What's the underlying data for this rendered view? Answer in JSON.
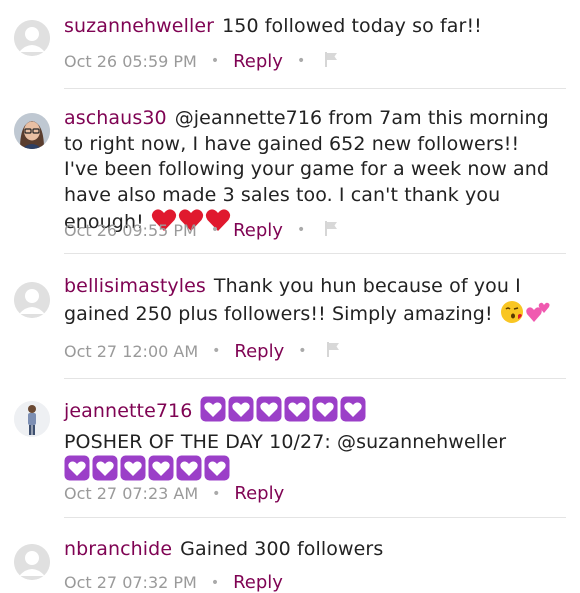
{
  "comments": [
    {
      "username": "suzannehweller",
      "text": "150 followed today so far!!",
      "timestamp": "Oct 26 05:59 PM",
      "reply_label": "Reply",
      "avatar": "default-avatar",
      "has_flag": true
    },
    {
      "username": "aschaus30",
      "text": "@jeannette716 from 7am this morning to right now, I have gained 652 new followers!! I've been following your game for a week now and have also made 3 sales too. I can't thank you enough!",
      "emojis": [
        "red-heart",
        "red-heart",
        "red-heart"
      ],
      "timestamp": "Oct 26 09:55 PM",
      "reply_label": "Reply",
      "avatar": "photo-avatar-woman-glasses",
      "has_flag": true
    },
    {
      "username": "bellisimastyles",
      "text": "Thank you hun because of you I gained 250 plus followers!! Simply amazing!",
      "emojis": [
        "kissing-face",
        "two-hearts"
      ],
      "timestamp": "Oct 27 12:00 AM",
      "reply_label": "Reply",
      "avatar": "default-avatar",
      "has_flag": true
    },
    {
      "username": "jeannette716",
      "text": "POSHER OF THE DAY 10/27: @suzannehweller",
      "emojis": [
        "heart-decoration",
        "heart-decoration",
        "heart-decoration",
        "heart-decoration",
        "heart-decoration",
        "heart-decoration"
      ],
      "timestamp": "Oct 27 07:23 AM",
      "reply_label": "Reply",
      "avatar": "photo-avatar-woman-standing",
      "has_flag": false
    },
    {
      "username": "nbranchide",
      "text": "Gained 300 followers",
      "timestamp": "Oct 27 07:32 PM",
      "reply_label": "Reply",
      "avatar": "default-avatar",
      "has_flag": true
    }
  ],
  "colors": {
    "username": "#7f0353",
    "reply": "#7f0353",
    "meta": "#9a9a9a",
    "heart_red": "#e0192e",
    "heart_box_purple": "#9b3fc8"
  }
}
